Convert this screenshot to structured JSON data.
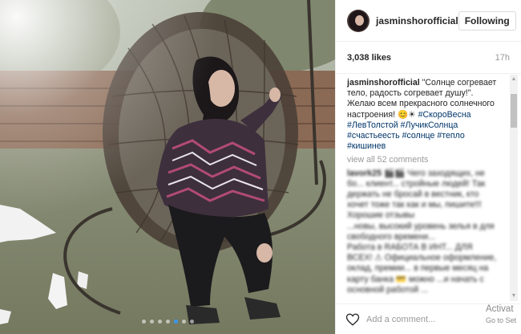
{
  "post": {
    "username": "jasminshorofficial",
    "follow_label": "Following",
    "likes": "3,038 likes",
    "time": "17h",
    "caption_user": "jasminshorofficial",
    "caption_text": " \"Солнце согревает тело, радость согревает душу!\". Желаю всем прекрасного солнечного настроения! 😊☀",
    "hashtags": [
      "#СкороВесна",
      "#ЛевТолстой",
      "#ЛучикСолнца",
      "#счастьеесть",
      "#солнце",
      "#тепло",
      "#кишинев"
    ],
    "view_all": "view all 52 comments",
    "add_comment_placeholder": "Add a comment...",
    "more_icon": "ellipsis-icon",
    "like_icon": "heart-icon"
  },
  "blurred_comments": [
    {
      "user": "lavork25",
      "text": "🎬🎬 Чего заходящих, не бо... клиент... стройные людей! Так держать не бросай в вестник, кто хочет тоже так как и мы, пишите!!! Хорошие отзывы"
    },
    {
      "user": "",
      "text": "...новы, высокий уровень зелья в для свободного времени..."
    },
    {
      "user": "",
      "text": "Работа в RAБОТА В ИНТ... ДЛЯ ВСЕХ! ⚠ Официальное оформление, оклад, премии... в первые месяц на карту банка 💳 можно ...и начать с основной работой ..."
    }
  ],
  "watermark": {
    "line1": "Activat",
    "line2": "Go to Set"
  },
  "carousel": {
    "count": 7,
    "active": 4
  },
  "colors": {
    "link": "#003569",
    "accent": "#3897f0",
    "muted": "#999999",
    "border": "#efefef"
  }
}
